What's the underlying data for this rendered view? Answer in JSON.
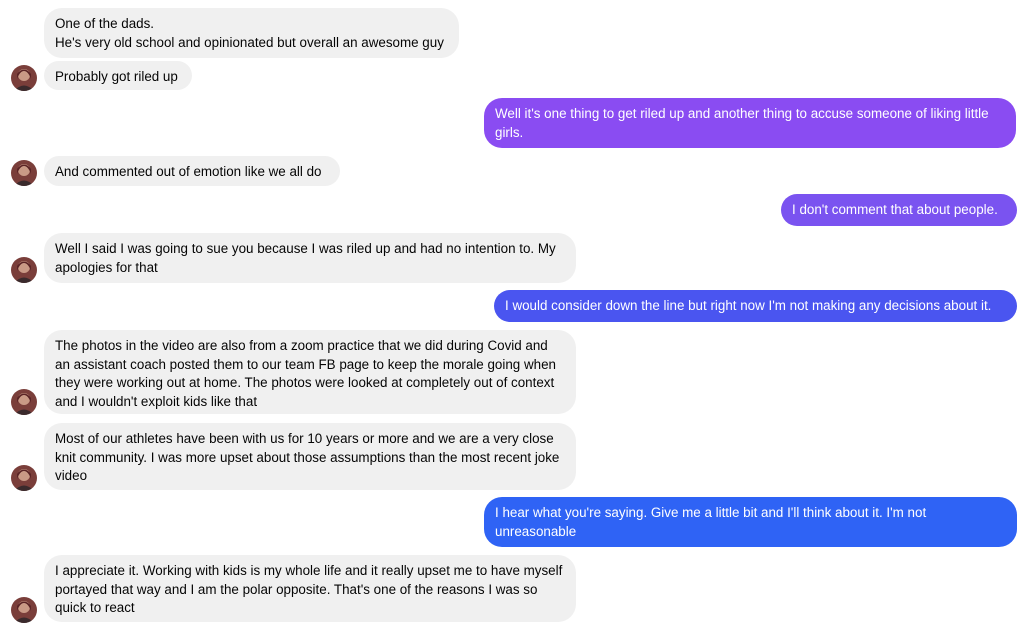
{
  "conversation": {
    "messages": [
      {
        "id": "m1",
        "sender": "contact",
        "text": "One of the dads.\nHe's very old school and opinionated but overall an awesome guy"
      },
      {
        "id": "m2",
        "sender": "contact",
        "text": "Probably got riled up"
      },
      {
        "id": "m3",
        "sender": "me",
        "text": "Well it's one thing to get riled up and another thing to accuse someone of liking little girls."
      },
      {
        "id": "m4",
        "sender": "contact",
        "text": "And commented out of emotion like we all do"
      },
      {
        "id": "m5",
        "sender": "me",
        "text": "I don't comment that about people."
      },
      {
        "id": "m6",
        "sender": "contact",
        "text": "Well I said I was going to sue you because I was riled up and had no intention to. My apologies for that"
      },
      {
        "id": "m7",
        "sender": "me",
        "text": "I would consider down the line but right now I'm not making any decisions about it."
      },
      {
        "id": "m8",
        "sender": "contact",
        "text": "The photos in the video are also from a zoom practice that we did during Covid and an assistant coach posted them to our team FB page to keep the morale going when they were working out at home. The photos were looked at completely out of context and I wouldn't exploit kids like that"
      },
      {
        "id": "m9",
        "sender": "contact",
        "text": "Most of our athletes have been with us for 10 years or more and we are a very close knit community. I was more upset about those assumptions than the most recent joke video"
      },
      {
        "id": "m10",
        "sender": "me",
        "text": "I hear what you're saying. Give me a little bit and I'll think about it. I'm not unreasonable"
      },
      {
        "id": "m11",
        "sender": "contact",
        "text": "I appreciate it. Working with kids is my whole life and it really upset me to have myself portayed that way and I am the polar opposite. That's one of the reasons I was so quick to react"
      }
    ]
  },
  "colors": {
    "incoming_bubble": "#f0f0f0",
    "outgoing_purple": "#8a4cf2",
    "outgoing_violet": "#7a53f0",
    "outgoing_blue": "#4a55f0",
    "outgoing_royal": "#2f63f5"
  },
  "icons": {
    "contact_avatar": "avatar-photo"
  }
}
